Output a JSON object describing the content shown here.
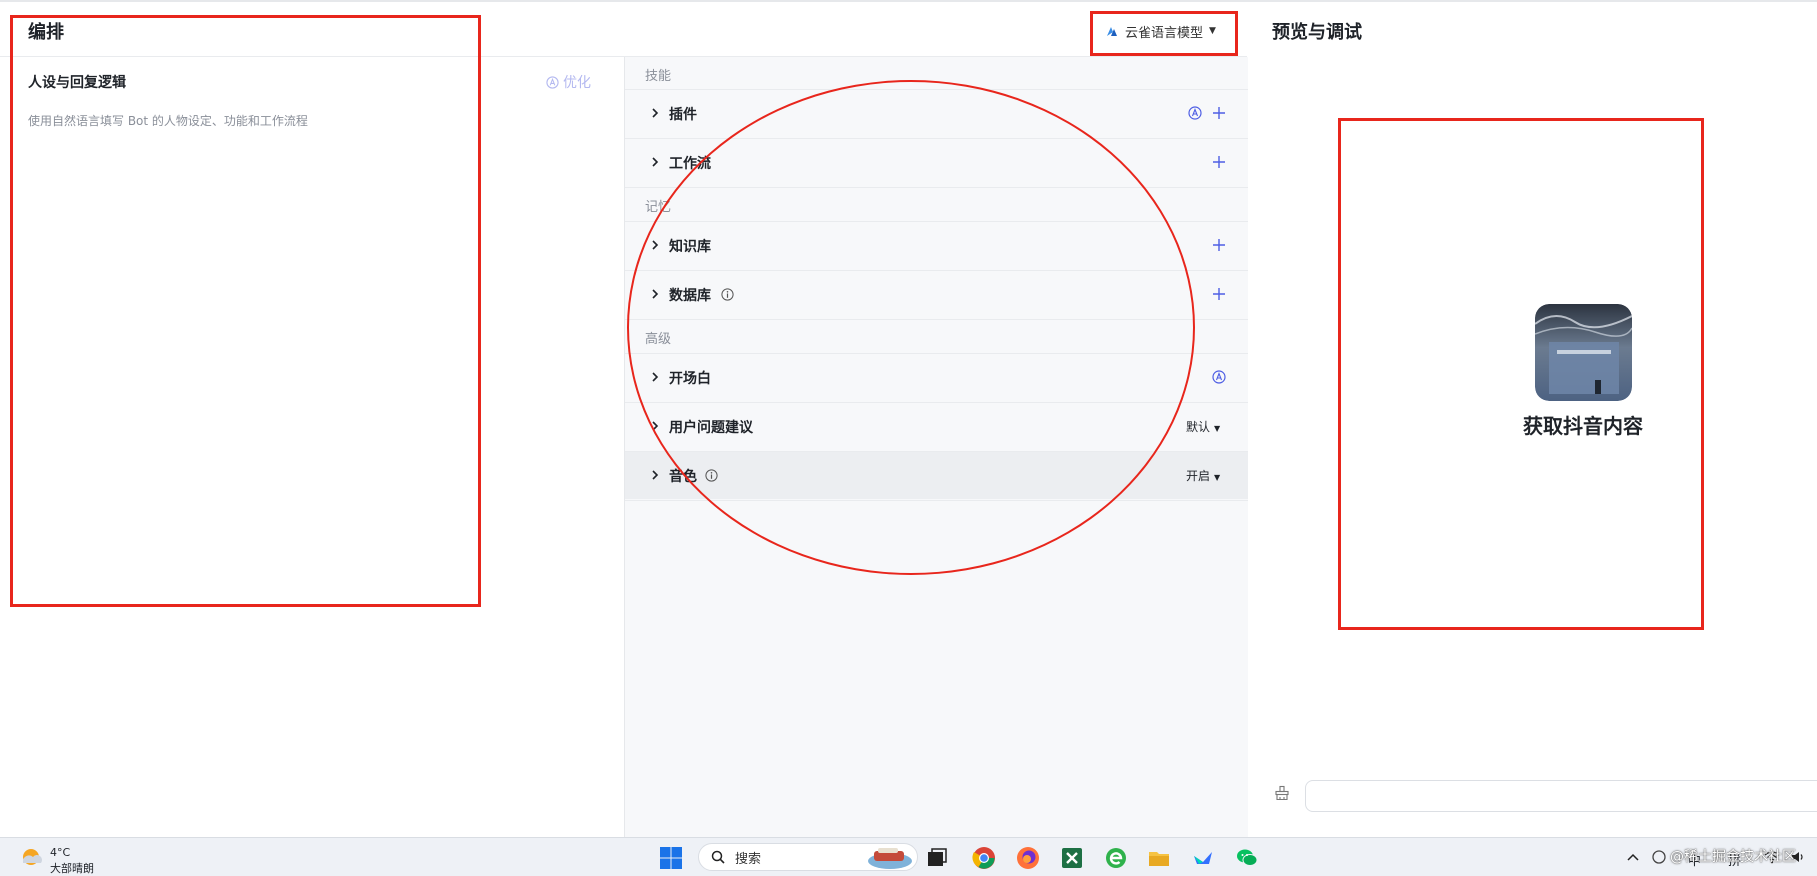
{
  "header": {
    "title": "编排",
    "model_selector": "云雀语言模型",
    "preview_title": "预览与调试"
  },
  "persona": {
    "title": "人设与回复逻辑",
    "optimize_label": "优化",
    "placeholder": "使用自然语言填写 Bot 的人物设定、功能和工作流程"
  },
  "skills": {
    "section_label": "技能",
    "plugin_label": "插件",
    "workflow_label": "工作流"
  },
  "memory": {
    "section_label": "记忆",
    "knowledge_label": "知识库",
    "database_label": "数据库"
  },
  "advanced": {
    "section_label": "高级",
    "opening_label": "开场白",
    "suggestions_label": "用户问题建议",
    "suggestions_value": "默认",
    "voice_label": "音色",
    "voice_value": "开启"
  },
  "preview": {
    "bot_name": "获取抖音内容"
  },
  "taskbar": {
    "temperature": "4°C",
    "weather": "大部晴朗",
    "search_label": "搜索",
    "ime_lang": "中",
    "ime_mode": "拼"
  },
  "watermark": "@稀土掘金技术社区",
  "colors": {
    "accent": "#4e5ee4",
    "annotation": "#e8261c",
    "panel_bg": "#f7f8fa"
  }
}
